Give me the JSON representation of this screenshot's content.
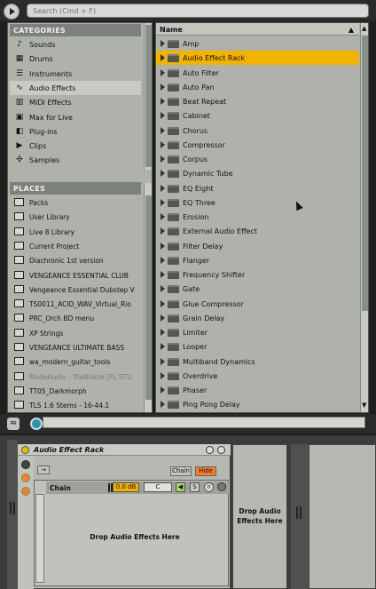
{
  "search": {
    "placeholder": "Search (Cmd + F)"
  },
  "browser": {
    "categories_header": "CATEGORIES",
    "categories": [
      {
        "label": "Sounds",
        "icon": "note-icon"
      },
      {
        "label": "Drums",
        "icon": "drum-grid-icon"
      },
      {
        "label": "Instruments",
        "icon": "keyboard-icon"
      },
      {
        "label": "Audio Effects",
        "icon": "waveform-icon",
        "selected": true
      },
      {
        "label": "MIDI Effects",
        "icon": "midi-icon"
      },
      {
        "label": "Max for Live",
        "icon": "max-icon"
      },
      {
        "label": "Plug-ins",
        "icon": "plug-icon"
      },
      {
        "label": "Clips",
        "icon": "clip-icon"
      },
      {
        "label": "Samples",
        "icon": "sample-icon"
      }
    ],
    "places_header": "PLACES",
    "places": [
      {
        "label": "Packs"
      },
      {
        "label": "User Library"
      },
      {
        "label": "Live 8 Library"
      },
      {
        "label": "Current Project"
      },
      {
        "label": "Diachronic 1st version"
      },
      {
        "label": "VENGEANCE ESSENTIAL CLUB"
      },
      {
        "label": "Vengeance Essential Dubstep V"
      },
      {
        "label": "TS0011_ACID_WAV_Virtual_Rio"
      },
      {
        "label": "PRC_Orch BD menu"
      },
      {
        "label": "XP Strings"
      },
      {
        "label": "VENGEANCE ULTIMATE BASS"
      },
      {
        "label": "wa_modern_guitar_tools"
      },
      {
        "label": "ModeAudio - Trailblaze [FL STU",
        "dim": true
      },
      {
        "label": "TT05_Darkmorph"
      },
      {
        "label": "TLS 1.6 Stems - 16-44.1"
      }
    ],
    "name_header": "Name",
    "items": [
      {
        "label": "Amp"
      },
      {
        "label": "Audio Effect Rack",
        "selected": true
      },
      {
        "label": "Auto Filter"
      },
      {
        "label": "Auto Pan"
      },
      {
        "label": "Beat Repeat"
      },
      {
        "label": "Cabinet"
      },
      {
        "label": "Chorus"
      },
      {
        "label": "Compressor"
      },
      {
        "label": "Corpus"
      },
      {
        "label": "Dynamic Tube"
      },
      {
        "label": "EQ Eight"
      },
      {
        "label": "EQ Three"
      },
      {
        "label": "Erosion"
      },
      {
        "label": "External Audio Effect"
      },
      {
        "label": "Filter Delay"
      },
      {
        "label": "Flanger"
      },
      {
        "label": "Frequency Shifter"
      },
      {
        "label": "Gate"
      },
      {
        "label": "Glue Compressor"
      },
      {
        "label": "Grain Delay"
      },
      {
        "label": "Limiter"
      },
      {
        "label": "Looper"
      },
      {
        "label": "Multiband Dynamics"
      },
      {
        "label": "Overdrive"
      },
      {
        "label": "Phaser"
      },
      {
        "label": "Ping Pong Delay"
      }
    ]
  },
  "rack": {
    "title": "Audio Effect Rack",
    "chain_button": "Chain",
    "hide_button": "Hide",
    "chain_list_icon": "→",
    "chain": {
      "name": "Chain",
      "volume": "0.0 dB",
      "pan": "C",
      "solo": "S"
    },
    "drop_effects_text": "Drop Audio Effects Here"
  },
  "drop_audio_text": "Drop Audio Effects Here",
  "colors": {
    "selection": "#f2b200",
    "panel": "#aeb2ab",
    "hide_active": "#f08030"
  }
}
